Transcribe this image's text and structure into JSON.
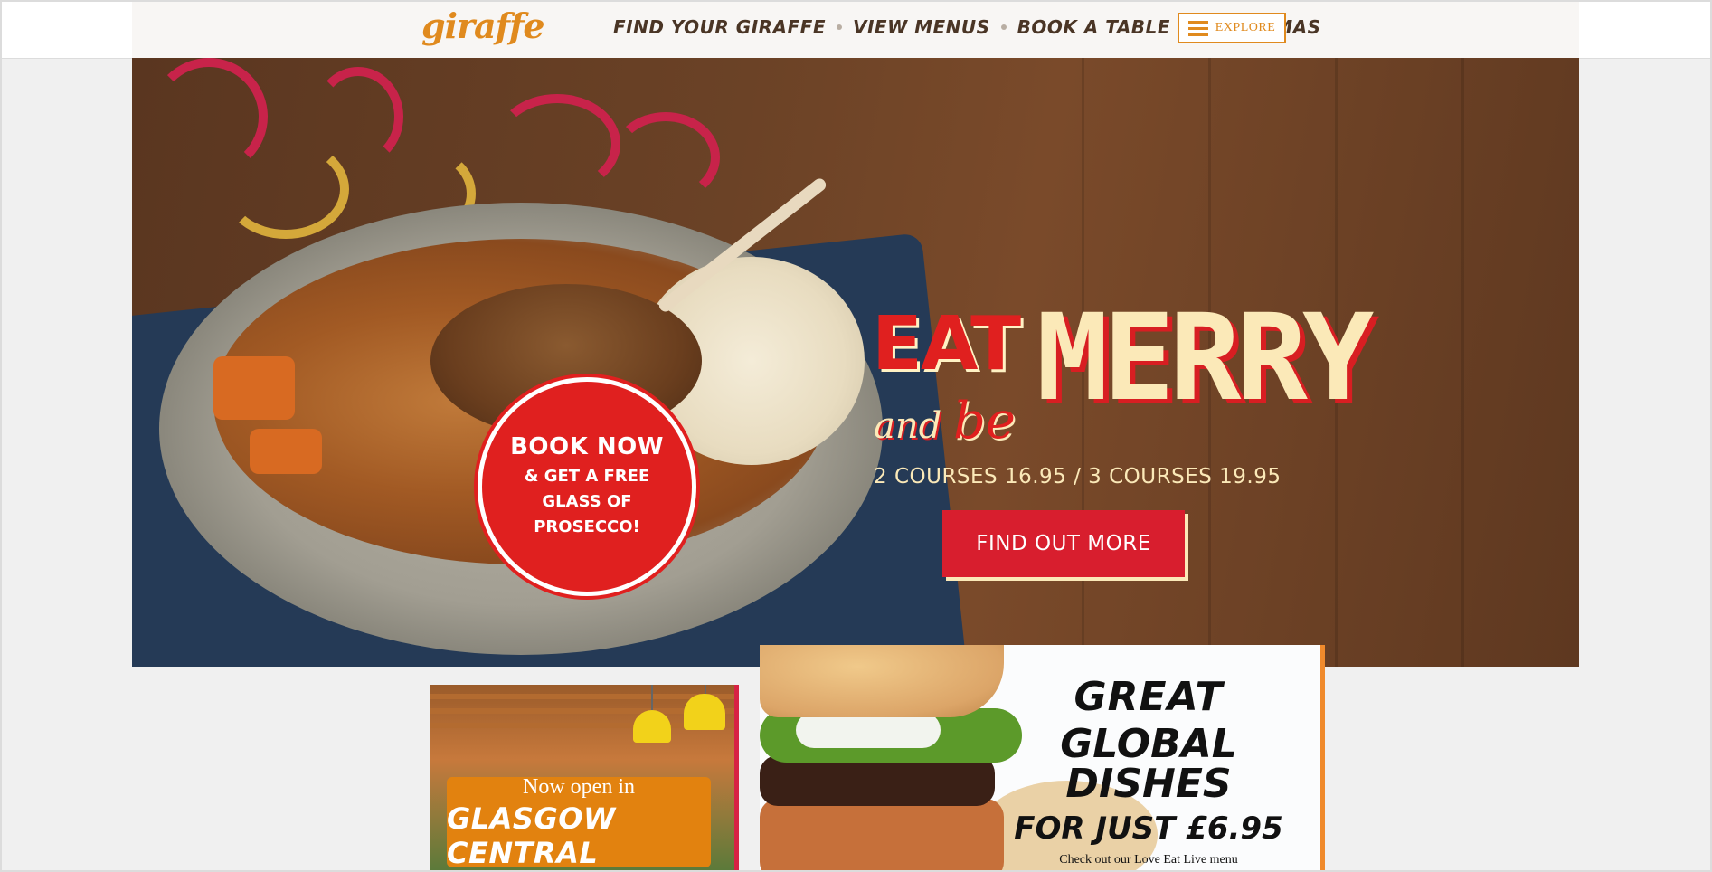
{
  "header": {
    "logo": "giraffe",
    "nav": [
      "FIND YOUR GIRAFFE",
      "VIEW MENUS",
      "BOOK A TABLE",
      "CHRISTMAS"
    ],
    "explore_label": "EXPLORE"
  },
  "hero": {
    "badge_title": "BOOK NOW",
    "badge_sub": "& GET A FREE GLASS OF PROSECCO!",
    "headline_eat": "EAT",
    "headline_and": "and",
    "headline_be": "be",
    "headline_merry": "MERRY",
    "courses": "2 COURSES 16.95 / 3 COURSES 19.95",
    "cta": "FIND OUT MORE"
  },
  "promo_glasgow": {
    "top": "Now open in",
    "main": "GLASGOW CENTRAL"
  },
  "promo_dishes": {
    "line1": "GREAT",
    "line2": "GLOBAL DISHES",
    "line3": "FOR JUST £6.95",
    "sub": "Check out our Love Eat Live menu"
  },
  "icons": {
    "menu": "hamburger-icon"
  },
  "colors": {
    "brand_orange": "#e08a1e",
    "brand_red": "#e0201f",
    "cream": "#fbe9b8"
  }
}
